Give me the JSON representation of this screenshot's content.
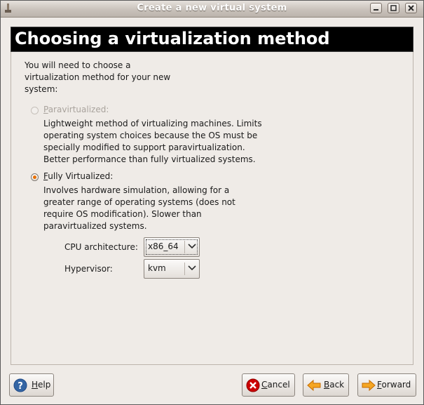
{
  "window": {
    "title": "Create a new virtual system"
  },
  "header": {
    "title": "Choosing a virtualization method"
  },
  "intro": [
    "You will need to choose a",
    "virtualization method for your new",
    "system:"
  ],
  "options": {
    "paravirtualized": {
      "label_mnemonic": "P",
      "label_rest": "aravirtualized:",
      "selected": false,
      "enabled": false,
      "description": [
        "Lightweight method of virtualizing machines. Limits",
        "operating system choices because the OS must be",
        "specially modified to support paravirtualization.",
        "Better performance than fully virtualized systems."
      ]
    },
    "fully_virtualized": {
      "label_mnemonic": "F",
      "label_rest": "ully Virtualized:",
      "selected": true,
      "enabled": true,
      "description": [
        "Involves hardware simulation, allowing for a",
        "greater range of operating systems (does not",
        "require OS modification). Slower than",
        "paravirtualized systems."
      ]
    }
  },
  "cpu_architecture": {
    "label": "CPU architecture:",
    "value": "x86_64"
  },
  "hypervisor": {
    "label": "Hypervisor:",
    "value": "kvm"
  },
  "buttons": {
    "help": {
      "mnemonic": "H",
      "rest": "elp"
    },
    "cancel": {
      "mnemonic": "C",
      "rest": "ancel"
    },
    "back": {
      "mnemonic": "B",
      "rest": "ack"
    },
    "forward": {
      "mnemonic": "F",
      "rest": "orward"
    }
  },
  "colors": {
    "accent": "#e76f00",
    "header_bg": "#000000",
    "window_bg": "#efebe7"
  }
}
